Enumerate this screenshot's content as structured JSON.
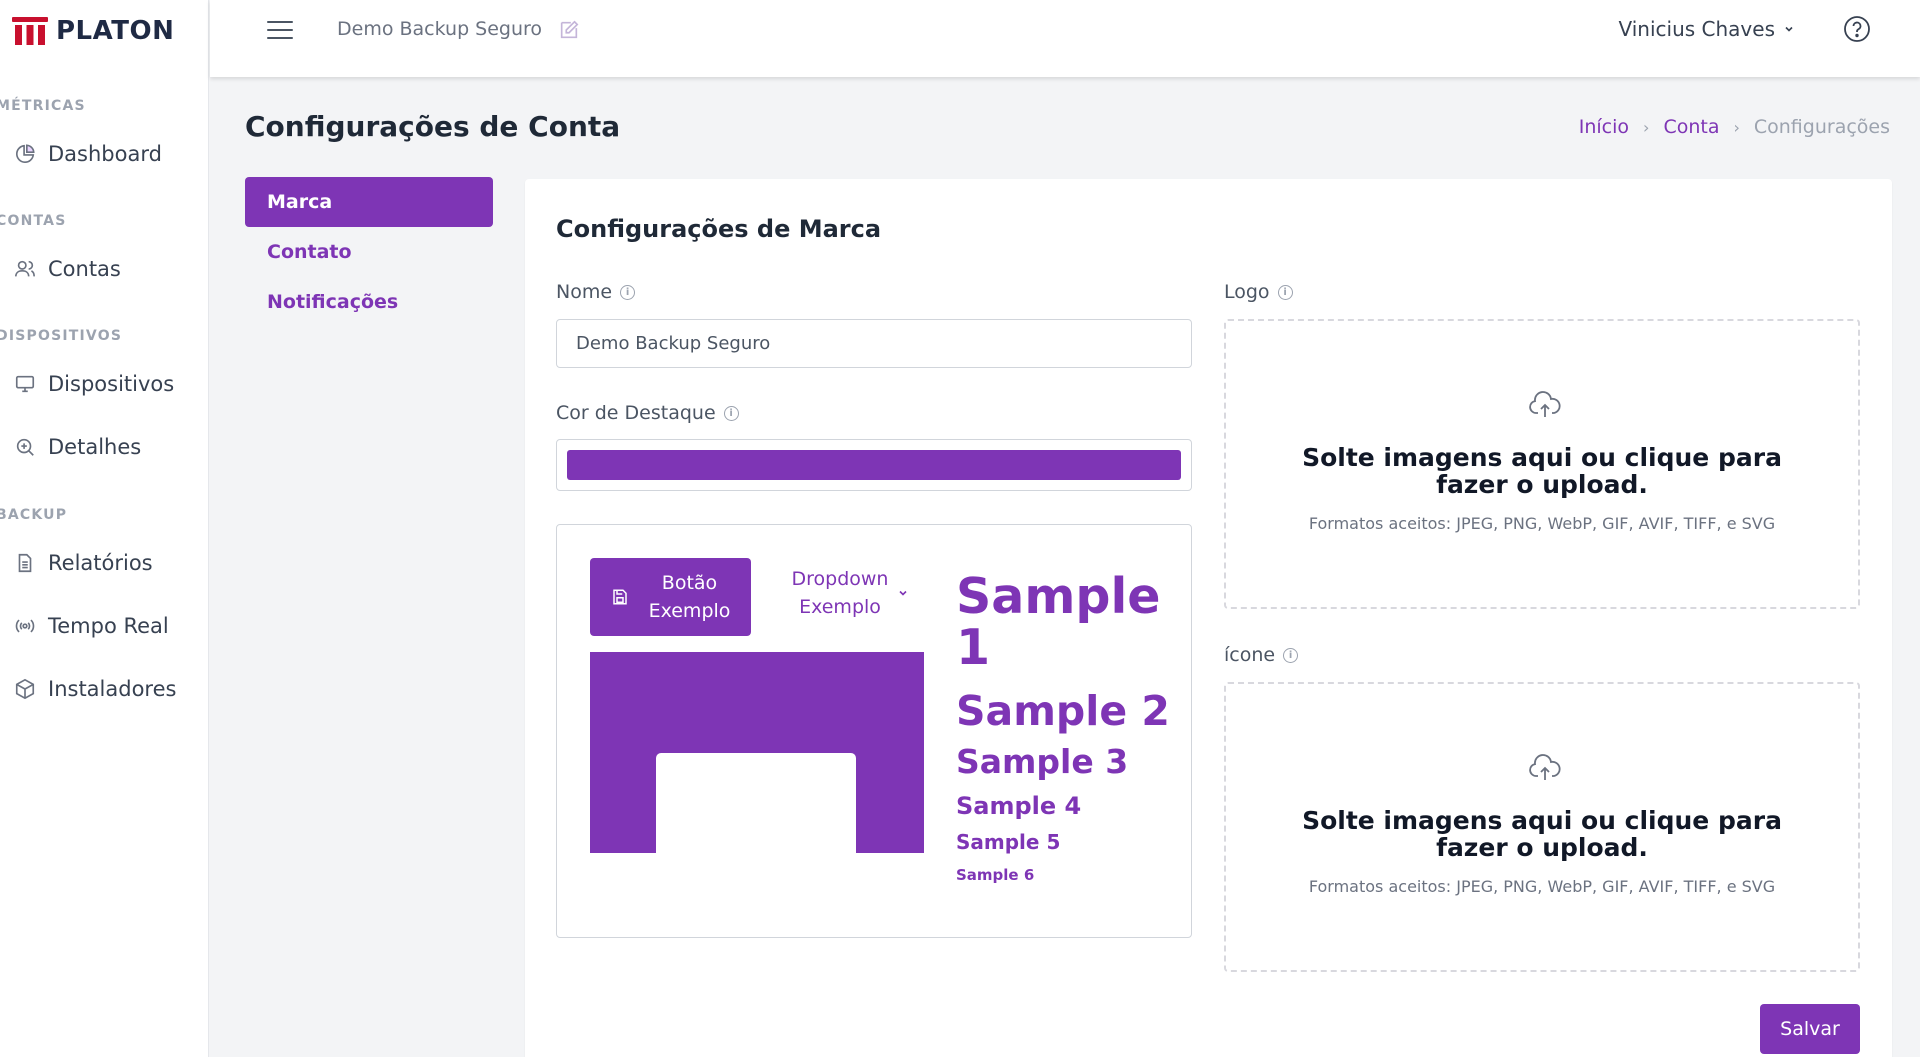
{
  "brand": {
    "name": "PLATON",
    "accent": "#7e35b5",
    "logo_color": "#c8102e"
  },
  "sidebar": {
    "sections": [
      {
        "label": "MÉTRICAS",
        "items": [
          {
            "label": "Dashboard",
            "icon": "chart-pie-icon"
          }
        ]
      },
      {
        "label": "CONTAS",
        "items": [
          {
            "label": "Contas",
            "icon": "users-icon"
          }
        ]
      },
      {
        "label": "DISPOSITIVOS",
        "items": [
          {
            "label": "Dispositivos",
            "icon": "monitor-icon"
          },
          {
            "label": "Detalhes",
            "icon": "zoom-in-icon"
          }
        ]
      },
      {
        "label": "BACKUP",
        "items": [
          {
            "label": "Relatórios",
            "icon": "document-icon"
          },
          {
            "label": "Tempo Real",
            "icon": "broadcast-icon"
          },
          {
            "label": "Instaladores",
            "icon": "package-icon"
          }
        ]
      }
    ]
  },
  "topbar": {
    "org_name": "Demo Backup Seguro",
    "user_name": "Vinicius Chaves"
  },
  "page": {
    "title": "Configurações de Conta",
    "breadcrumb": [
      "Início",
      "Conta",
      "Configurações"
    ]
  },
  "settings_nav": [
    "Marca",
    "Contato",
    "Notificações"
  ],
  "brand_settings": {
    "title": "Configurações de Marca",
    "name_label": "Nome",
    "name_value": "Demo Backup Seguro",
    "color_label": "Cor de Destaque",
    "color_value": "#7e35b5",
    "preview": {
      "button_label_1": "Botão",
      "button_label_2": "Exemplo",
      "dropdown_label_1": "Dropdown",
      "dropdown_label_2": "Exemplo",
      "samples": [
        "Sample 1",
        "Sample 2",
        "Sample 3",
        "Sample 4",
        "Sample 5",
        "Sample 6"
      ]
    },
    "logo_label": "Logo",
    "icon_label": "ícone",
    "dropzone_title": "Solte imagens aqui ou clique para fazer o upload.",
    "dropzone_formats": "Formatos aceitos: JPEG, PNG, WebP, GIF, AVIF, TIFF, e SVG",
    "save_label": "Salvar"
  }
}
